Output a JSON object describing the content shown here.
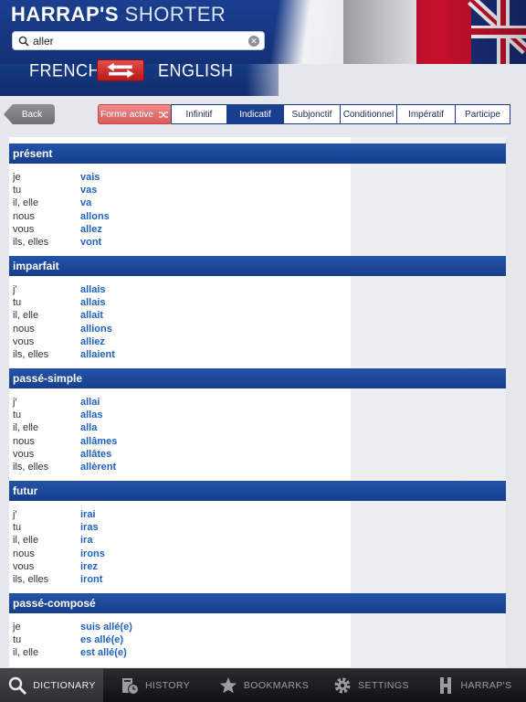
{
  "header": {
    "brand_bold": "HARRAP'S",
    "brand_light": "SHORTER",
    "search_value": "aller",
    "lang_from": "FRENCH",
    "lang_to": "ENGLISH"
  },
  "controls": {
    "back_label": "Back",
    "forme_label": "Forme active",
    "tabs": [
      "Infinitif",
      "Indicatif",
      "Subjonctif",
      "Conditionnel",
      "Impératif",
      "Participe"
    ],
    "active_tab": "Indicatif"
  },
  "sections": [
    {
      "title": "présent",
      "rows": [
        [
          "je",
          "vais"
        ],
        [
          "tu",
          "vas"
        ],
        [
          "il, elle",
          "va"
        ],
        [
          "nous",
          "allons"
        ],
        [
          "vous",
          "allez"
        ],
        [
          "ils, elles",
          "vont"
        ]
      ]
    },
    {
      "title": "imparfait",
      "rows": [
        [
          "j'",
          "allais"
        ],
        [
          "tu",
          "allais"
        ],
        [
          "il, elle",
          "allait"
        ],
        [
          "nous",
          "allions"
        ],
        [
          "vous",
          "alliez"
        ],
        [
          "ils, elles",
          "allaient"
        ]
      ]
    },
    {
      "title": "passé-simple",
      "rows": [
        [
          "j'",
          "allai"
        ],
        [
          "tu",
          "allas"
        ],
        [
          "il, elle",
          "alla"
        ],
        [
          "nous",
          "allâmes"
        ],
        [
          "vous",
          "allâtes"
        ],
        [
          "ils, elles",
          "allèrent"
        ]
      ]
    },
    {
      "title": "futur",
      "rows": [
        [
          "j'",
          "irai"
        ],
        [
          "tu",
          "iras"
        ],
        [
          "il, elle",
          "ira"
        ],
        [
          "nous",
          "irons"
        ],
        [
          "vous",
          "irez"
        ],
        [
          "ils, elles",
          "iront"
        ]
      ]
    },
    {
      "title": "passé-composé",
      "rows": [
        [
          "je",
          "suis allé(e)"
        ],
        [
          "tu",
          "es allé(e)"
        ],
        [
          "il, elle",
          "est allé(e)"
        ]
      ]
    }
  ],
  "tabbar": [
    {
      "label": "DICTIONARY",
      "icon": "magnifier-icon",
      "active": true
    },
    {
      "label": "HISTORY",
      "icon": "history-book-icon",
      "active": false
    },
    {
      "label": "BOOKMARKS",
      "icon": "star-icon",
      "active": false
    },
    {
      "label": "SETTINGS",
      "icon": "gear-icon",
      "active": false
    },
    {
      "label": "HARRAP'S",
      "icon": "harraps-h-icon",
      "active": false
    }
  ],
  "colors": {
    "accent": "#1b3f8f",
    "form_text": "#1f62c0",
    "forme_button": "#d85b5b"
  }
}
